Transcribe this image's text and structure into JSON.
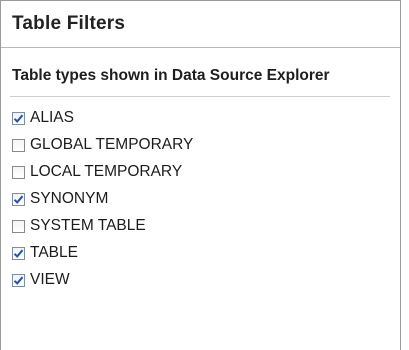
{
  "panel": {
    "title": "Table Filters",
    "group_label": "Table types shown in Data Source Explorer"
  },
  "table_types": [
    {
      "label": "ALIAS",
      "checked": true
    },
    {
      "label": "GLOBAL TEMPORARY",
      "checked": false
    },
    {
      "label": "LOCAL TEMPORARY",
      "checked": false
    },
    {
      "label": "SYNONYM",
      "checked": true
    },
    {
      "label": "SYSTEM TABLE",
      "checked": false
    },
    {
      "label": "TABLE",
      "checked": true
    },
    {
      "label": "VIEW",
      "checked": true
    }
  ],
  "colors": {
    "check_mark": "#2a4fa8"
  },
  "icons": {
    "checkbox_checked": "checkbox-checked-icon",
    "checkbox_unchecked": "checkbox-unchecked-icon"
  }
}
